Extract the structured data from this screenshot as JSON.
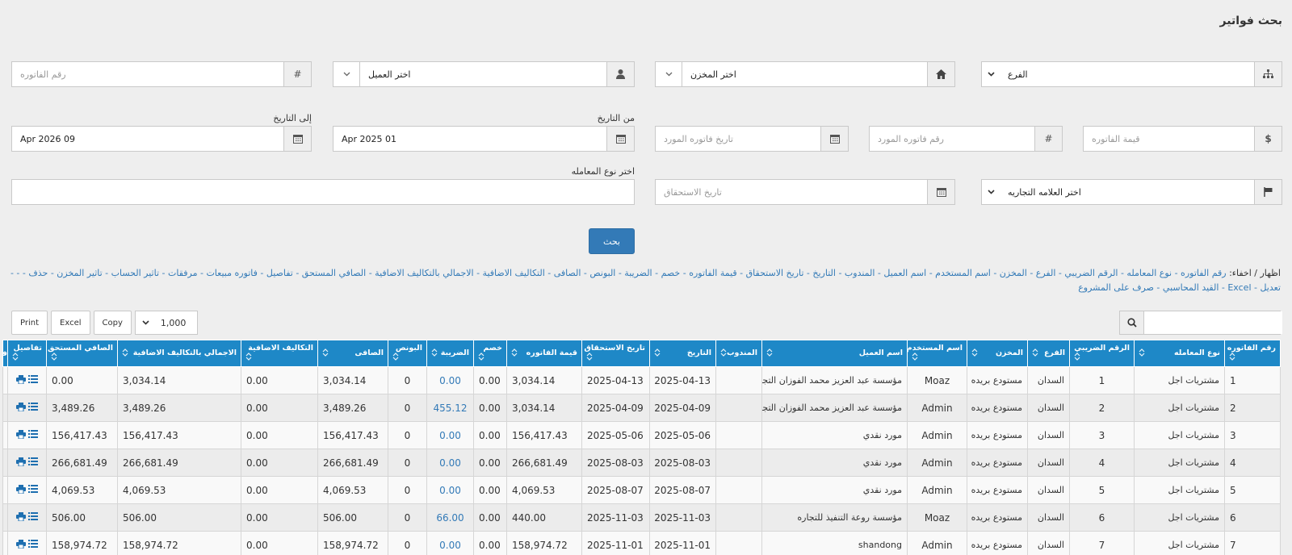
{
  "page_title": "بحث فواتير",
  "filters": {
    "branch_placeholder": "الفرع",
    "store_placeholder": "اختر المخزن",
    "customer_placeholder": "اختر العميل",
    "invoice_no_placeholder": "رقم الفاتوره",
    "invoice_value_placeholder": "قيمة الفاتوره",
    "supplier_invoice_no_placeholder": "رقم فاتوره المورد",
    "supplier_invoice_date_placeholder": "تاريخ فاتوره المورد",
    "from_date_label": "من التاريخ",
    "from_date_value": "01 Apr 2025",
    "to_date_label": "إلى التاريخ",
    "to_date_value": "09 Apr 2026",
    "brand_placeholder": "اختر العلامه التجاريه",
    "due_date_placeholder": "تاريخ الاستحقاق",
    "transaction_type_label": "اختر نوع المعامله",
    "search_button": "بحث"
  },
  "column_toggle": {
    "lead": "اظهار / اخفاء:",
    "items": "رقم الفاتوره - نوع المعامله - الرقم الضريبي - الفرع - المخزن - اسم المستخدم - اسم العميل - المندوب - التاريخ - تاريخ الاستحقاق - قيمة الفاتوره - خصم - الضريبة - البونص - الصافى - التكاليف الاضافية - الاجمالي بالتكاليف الاضافية - الصافي المستحق - تفاصيل - فاتوره مبيعات - مرفقات - تاثير الحساب - تاثير المخزن - حذف - - - تعديل - Excel - القيد المحاسبي - صرف على المشروع"
  },
  "toolbar": {
    "print": "Print",
    "excel": "Excel",
    "copy": "Copy",
    "page_length": "1,000"
  },
  "table": {
    "headers": [
      "رقم الفاتوره",
      "نوع المعامله",
      "الرقم الضريبي",
      "الفرع",
      "المخزن",
      "اسم المستخدم",
      "اسم العميل",
      "المندوب",
      "التاريخ",
      "تاريخ الاستحقاق",
      "قيمة الفاتوره",
      "خصم",
      "الضريبة",
      "البونص",
      "الصافى",
      "التكاليف الاضافية",
      "الاجمالي بالتكاليف الاضافية",
      "الصافي المستحق",
      "تفاصيل",
      "ف"
    ],
    "rows": [
      [
        "1",
        "مشتريات اجل",
        "1",
        "السدان",
        "مستودع بريده",
        "Moaz",
        "مؤسسة عبد العزيز محمد الفوزان التجارية",
        "",
        "2025-04-13",
        "2025-04-13",
        "3,034.14",
        "0.00",
        "0.00",
        "0",
        "3,034.14",
        "0.00",
        "3,034.14",
        "0.00"
      ],
      [
        "2",
        "مشتريات اجل",
        "2",
        "السدان",
        "مستودع بريده",
        "Admin",
        "مؤسسة عبد العزيز محمد الفوزان التجارية",
        "",
        "2025-04-09",
        "2025-04-09",
        "3,034.14",
        "0.00",
        "455.12",
        "0",
        "3,489.26",
        "0.00",
        "3,489.26",
        "3,489.26"
      ],
      [
        "3",
        "مشتريات اجل",
        "3",
        "السدان",
        "مستودع بريده",
        "Admin",
        "مورد نقدي",
        "",
        "2025-05-06",
        "2025-05-06",
        "156,417.43",
        "0.00",
        "0.00",
        "0",
        "156,417.43",
        "0.00",
        "156,417.43",
        "156,417.43"
      ],
      [
        "4",
        "مشتريات اجل",
        "4",
        "السدان",
        "مستودع بريده",
        "Admin",
        "مورد نقدي",
        "",
        "2025-08-03",
        "2025-08-03",
        "266,681.49",
        "0.00",
        "0.00",
        "0",
        "266,681.49",
        "0.00",
        "266,681.49",
        "266,681.49"
      ],
      [
        "5",
        "مشتريات اجل",
        "5",
        "السدان",
        "مستودع بريده",
        "Admin",
        "مورد نقدي",
        "",
        "2025-08-07",
        "2025-08-07",
        "4,069.53",
        "0.00",
        "0.00",
        "0",
        "4,069.53",
        "0.00",
        "4,069.53",
        "4,069.53"
      ],
      [
        "6",
        "مشتريات اجل",
        "6",
        "السدان",
        "مستودع بريده",
        "Moaz",
        "مؤسسة روعة التنفيذ للتجاره",
        "",
        "2025-11-03",
        "2025-11-03",
        "440.00",
        "0.00",
        "66.00",
        "0",
        "506.00",
        "0.00",
        "506.00",
        "506.00"
      ],
      [
        "7",
        "مشتريات اجل",
        "7",
        "السدان",
        "مستودع بريده",
        "Admin",
        "shandong",
        "",
        "2025-11-01",
        "2025-11-01",
        "158,974.72",
        "0.00",
        "0.00",
        "0",
        "158,974.72",
        "0.00",
        "158,974.72",
        "158,974.72"
      ]
    ]
  },
  "colors": {
    "header_bg": "#1e88c7",
    "link": "#337ab7",
    "primary_button": "#337ab7"
  }
}
